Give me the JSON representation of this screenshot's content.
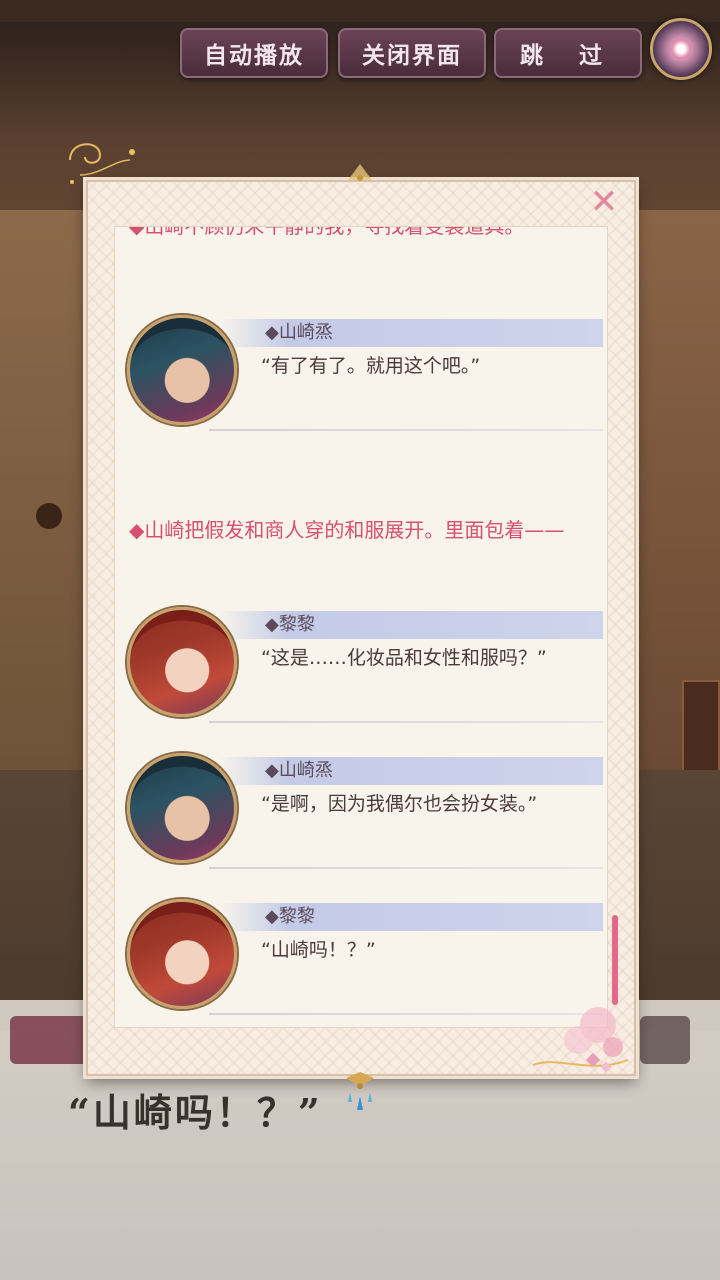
{
  "top_buttons": {
    "auto_play": "自动播放",
    "close_ui": "关闭界面",
    "skip": "跳 过"
  },
  "log": {
    "narration_cut": "◆山崎不顾仍未平静的我，寻找着变装道具。",
    "narration_2": "◆山崎把假发和商人穿的和服展开。里面包着——",
    "entries": [
      {
        "name": "◆山崎烝",
        "line": "“有了有了。就用这个吧。”",
        "avatar": "yamazaki"
      },
      {
        "name": "◆黎黎",
        "line": "“这是……化妆品和女性和服吗？”",
        "avatar": "lili"
      },
      {
        "name": "◆山崎烝",
        "line": "“是啊，因为我偶尔也会扮女装。”",
        "avatar": "yamazaki"
      },
      {
        "name": "◆黎黎",
        "line": "“山崎吗！？”",
        "avatar": "lili"
      }
    ]
  },
  "current_dialogue": "“山崎吗！？”",
  "colors": {
    "narration": "#d8506e",
    "button_bg": "#5a3848",
    "frame": "#f7ede3"
  }
}
